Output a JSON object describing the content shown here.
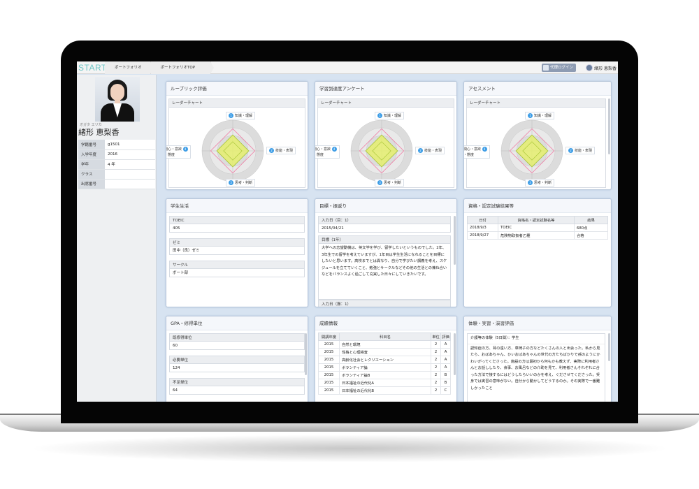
{
  "topbar": {
    "logo": "START",
    "breadcrumbs": [
      "ポートフォリオ",
      "ポートフォリオTOP"
    ],
    "proxy_login": "代理ログイン",
    "user_name": "緒形 恵梨香"
  },
  "profile": {
    "kana": "オガタ エリカ",
    "name": "緒形 恵梨香",
    "fields": [
      {
        "label": "学籍番号",
        "value": "g1501"
      },
      {
        "label": "入学年度",
        "value": "2016"
      },
      {
        "label": "学年",
        "value": "4 年"
      },
      {
        "label": "クラス",
        "value": ""
      },
      {
        "label": "出席番号",
        "value": ""
      }
    ]
  },
  "radar_labels": {
    "top": "知識・理解",
    "right": "技能・表現",
    "bottom": "思考・判断",
    "left_1": "関心・意欲",
    "left_2": "・態度",
    "num_top": "1",
    "num_right": "2",
    "num_bottom": "3",
    "num_left": "4"
  },
  "panels": {
    "rubric": {
      "title": "ルーブリック評価",
      "sub": "レーダーチャート"
    },
    "survey": {
      "title": "学習到達度アンケート",
      "sub": "レーダーチャート"
    },
    "assessment": {
      "title": "アセスメント",
      "sub": "レーダーチャート"
    },
    "student_life": {
      "title": "学生生活",
      "fields": [
        {
          "label": "TOEIC",
          "value": "405"
        },
        {
          "label": "ゼミ",
          "value": "田中（良）ゼミ"
        },
        {
          "label": "サークル",
          "value": "ボート部"
        }
      ]
    },
    "goals": {
      "title": "目標・振返り",
      "date_label": "入力日（目：1）",
      "date_value": "2015/04/21",
      "goal_label": "目標（1年）",
      "goal_text": "大学への志望動機は、英文学を学び、留学したいというものでした。2年、3年生での留学を考えていますが、1年目は学生生活になれることを目標にしたいと思います。高校までとは異なり、自分で学びたい講義を考え、スケジュールを立てていくこと、勉強とサークルなどその他の生活との兼ね合いなどをバランスよく過ごして充実した日々にしていきたいです。",
      "date2_label": "入力日（振：1）"
    },
    "certs": {
      "title": "資格・認定試験結果等",
      "headers": [
        "日付",
        "資格名・認定試験名等",
        "結果"
      ],
      "rows": [
        [
          "2018/9/3",
          "TOEIC",
          "680点"
        ],
        [
          "2018/9/27",
          "危険物取扱者乙種",
          "合格"
        ]
      ]
    },
    "gpa": {
      "title": "GPA・修得単位",
      "fields": [
        {
          "label": "既修得単位",
          "value": "60"
        },
        {
          "label": "必要単位",
          "value": "124"
        },
        {
          "label": "不足単位",
          "value": "64"
        }
      ]
    },
    "grades": {
      "title": "成績情報",
      "headers": [
        "開講年度",
        "科目名",
        "単位",
        "評価"
      ],
      "rows": [
        [
          "2015",
          "自然と環境",
          "2",
          "A"
        ],
        [
          "2015",
          "性格と心理検査",
          "2",
          "A"
        ],
        [
          "2015",
          "高齢化社会とレクリエーション",
          "2",
          "A"
        ],
        [
          "2015",
          "ボランティア論",
          "2",
          "A"
        ],
        [
          "2015",
          "ボランティア論B",
          "2",
          "B"
        ],
        [
          "2015",
          "日本福祉の近代化A",
          "2",
          "B"
        ],
        [
          "2015",
          "日本福祉の近代化B",
          "2",
          "C"
        ]
      ]
    },
    "experience": {
      "title": "体験・実習・演習評価",
      "heading": "介護等の体験（5日間）：学生",
      "text": "認知症の方、耳の遠い方、車椅子の方などたくさんの人と出会った。私から見たら、おばあちゃん、ひいおばあちゃんの世代の方たちばかりで孫のようにかわいがってくださった。施設の方は最初から何もかも教えず、実際に利用者さんとお話ししたり、食事、お風呂などの介助を見て、利用者さんそれぞれに合った方法で接するにはどうしたらいいのかを考え、ぐださせてくださった。受身では実習の意味がない。自分から動かしてどうするのか。その実際で一番難しかったこと"
    }
  }
}
